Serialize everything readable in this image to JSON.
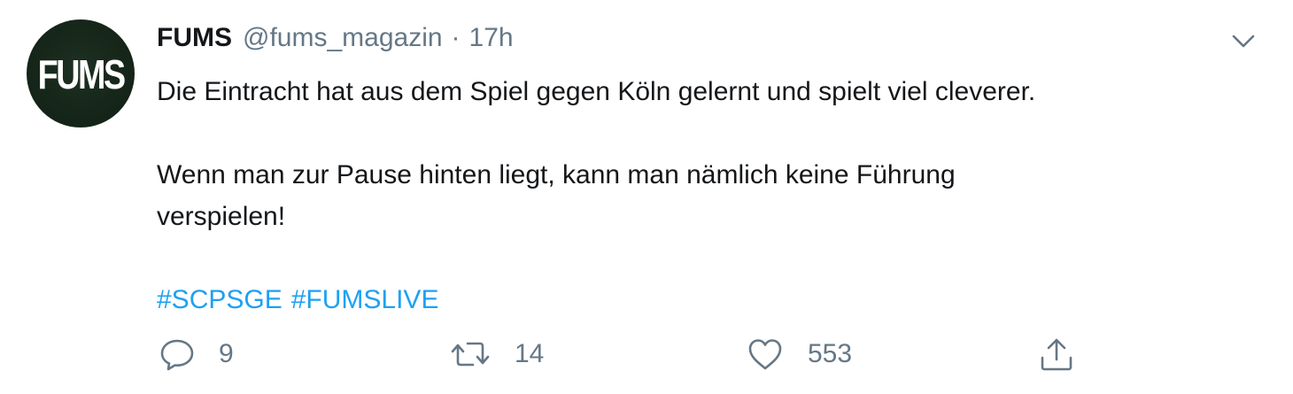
{
  "tweet": {
    "avatar": {
      "text": "FUMS",
      "background": "#142418"
    },
    "author": {
      "name": "FUMS",
      "handle": "@fums_magazin",
      "separator": "·",
      "time": "17h"
    },
    "menu_icon": "chevron-down-icon",
    "text": {
      "line1": "Die Eintracht hat aus dem Spiel gegen Köln gelernt und spielt viel cleverer.",
      "line2": "Wenn man zur Pause hinten liegt, kann man nämlich keine Führung",
      "line3": "verspielen!"
    },
    "hashtags": [
      "#SCPSGE",
      "#FUMSLIVE"
    ],
    "actions": {
      "reply": {
        "icon": "reply-icon",
        "count": "9"
      },
      "retweet": {
        "icon": "retweet-icon",
        "count": "14"
      },
      "like": {
        "icon": "heart-icon",
        "count": "553"
      },
      "share": {
        "icon": "share-icon"
      }
    },
    "colors": {
      "link": "#1da1f2",
      "secondary": "#657786",
      "primary": "#14171a"
    }
  }
}
